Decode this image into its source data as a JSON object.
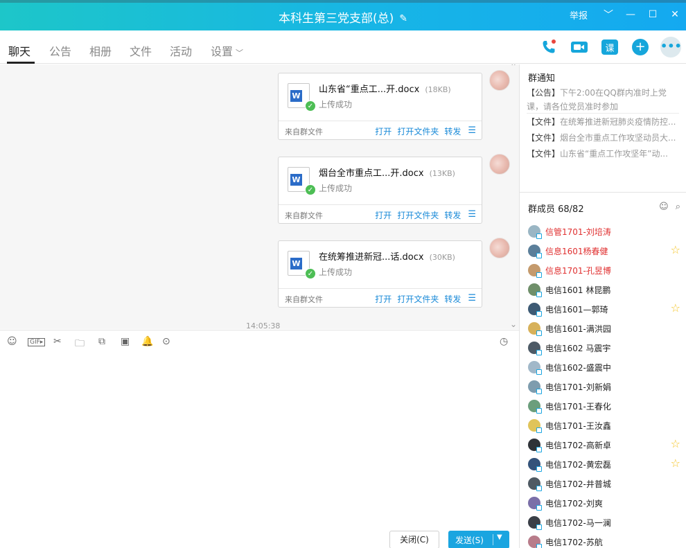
{
  "window": {
    "title": "本科生第三党支部(总)",
    "report_label": "举报",
    "edit_icon": "pencil-icon"
  },
  "tabs": [
    {
      "label": "聊天",
      "active": true
    },
    {
      "label": "公告"
    },
    {
      "label": "相册"
    },
    {
      "label": "文件"
    },
    {
      "label": "活动"
    },
    {
      "label": "设置"
    }
  ],
  "actions": {
    "course_label": "课"
  },
  "messages": [
    {
      "filename": "山东省“重点工...开.docx",
      "size": "(18KB)",
      "status": "上传成功",
      "from": "来自群文件",
      "open": "打开",
      "open_folder": "打开文件夹",
      "forward": "转发"
    },
    {
      "filename": "烟台全市重点工...开.docx",
      "size": "(13KB)",
      "status": "上传成功",
      "from": "来自群文件",
      "open": "打开",
      "open_folder": "打开文件夹",
      "forward": "转发"
    },
    {
      "filename": "在统筹推进新冠...话.docx",
      "size": "(30KB)",
      "status": "上传成功",
      "from": "来自群文件",
      "open": "打开",
      "open_folder": "打开文件夹",
      "forward": "转发"
    }
  ],
  "chat_time": "14:05:38",
  "input": {
    "close_label": "关闭(C)",
    "send_label": "发送(S)"
  },
  "notice": {
    "title": "群通知",
    "items": [
      {
        "tag": "【公告】",
        "text": "下午2:00在QQ群内准时上党课，请各位党员准时参加"
      },
      {
        "tag": "【文件】",
        "text": "在统筹推进新冠肺炎疫情防控..."
      },
      {
        "tag": "【文件】",
        "text": "烟台全市重点工作攻坚动员大..."
      },
      {
        "tag": "【文件】",
        "text": "山东省“重点工作攻坚年”动..."
      }
    ]
  },
  "members": {
    "title": "群成员 68/82",
    "list": [
      {
        "name": "信管1701-刘培涛",
        "red": true,
        "star": false
      },
      {
        "name": "信息1601杨春健",
        "red": true,
        "star": true
      },
      {
        "name": "信息1701-孔昱博",
        "red": true,
        "star": false
      },
      {
        "name": "电信1601 林昆鹏",
        "red": false,
        "star": false
      },
      {
        "name": "电信1601—郭琦",
        "red": false,
        "star": true
      },
      {
        "name": "电信1601-满洪园",
        "red": false,
        "star": false
      },
      {
        "name": "电信1602 马震宇",
        "red": false,
        "star": false
      },
      {
        "name": "电信1602-盛震中",
        "red": false,
        "star": false
      },
      {
        "name": "电信1701-刘新娟",
        "red": false,
        "star": false
      },
      {
        "name": "电信1701-王春化",
        "red": false,
        "star": false
      },
      {
        "name": "电信1701-王汝鑫",
        "red": false,
        "star": false
      },
      {
        "name": "电信1702-高新卓",
        "red": false,
        "star": true
      },
      {
        "name": "电信1702-黄宏磊",
        "red": false,
        "star": true
      },
      {
        "name": "电信1702-井普城",
        "red": false,
        "star": false
      },
      {
        "name": "电信1702-刘爽",
        "red": false,
        "star": false
      },
      {
        "name": "电信1702-马一澜",
        "red": false,
        "star": false
      },
      {
        "name": "电信1702-苏航",
        "red": false,
        "star": false
      }
    ]
  },
  "colors": {
    "accent": "#1aa5e0",
    "title_gradient_start": "#1dc6c9",
    "admin_red": "#e03030",
    "star": "#f4c21e"
  }
}
